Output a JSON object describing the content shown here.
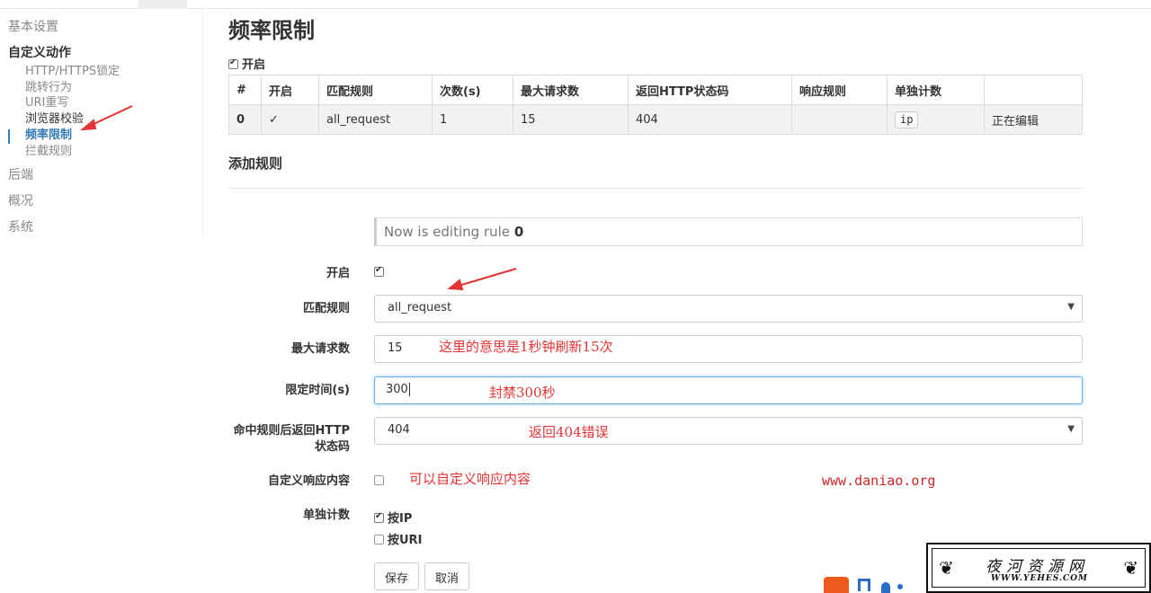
{
  "sidebar": {
    "basic": "基本设置",
    "custom_actions": "自定义动作",
    "sub_items": [
      "HTTP/HTTPS锁定",
      "跳转行为",
      "URI重写",
      "浏览器校验",
      "频率限制",
      "拦截规则"
    ],
    "backend": "后端",
    "overview": "概况",
    "system": "系统"
  },
  "page": {
    "title": "频率限制",
    "enable_label": "开启",
    "enabled": true
  },
  "rules_table": {
    "headers": [
      "#",
      "开启",
      "匹配规则",
      "次数(s)",
      "最大请求数",
      "返回HTTP状态码",
      "响应规则",
      "单独计数",
      ""
    ],
    "rows": [
      {
        "index": "0",
        "enabled": "✓",
        "match": "all_request",
        "times": "1",
        "max_requests": "15",
        "status": "404",
        "response": "",
        "count_by": "ip",
        "state": "正在编辑"
      }
    ]
  },
  "add_rule": {
    "title": "添加规则",
    "editing_prefix": "Now is editing rule",
    "editing_index": "0",
    "enable_label": "开启",
    "match_label": "匹配规则",
    "match_value": "all_request",
    "max_requests_label": "最大请求数",
    "max_requests_value": "15",
    "time_label": "限定时间(s)",
    "time_value": "300",
    "status_label_1": "命中规则后返回HTTP",
    "status_label_2": "状态码",
    "status_value": "404",
    "custom_response_label": "自定义响应内容",
    "count_label": "单独计数",
    "count_ip": "按IP",
    "count_uri": "按URI",
    "save": "保存",
    "cancel": "取消"
  },
  "annotations": {
    "max_note": "这里的意思是1秒钟刷新15次",
    "ban_note": "封禁300秒",
    "status_note": "返回404错误",
    "custom_note": "可以自定义响应内容",
    "watermark": "www.daniao.org"
  },
  "logo": {
    "title": "夜河资源网",
    "url": "WWW.YEHES.COM"
  },
  "colors": {
    "accent": "#337ab7",
    "annotation": "#e53333"
  }
}
